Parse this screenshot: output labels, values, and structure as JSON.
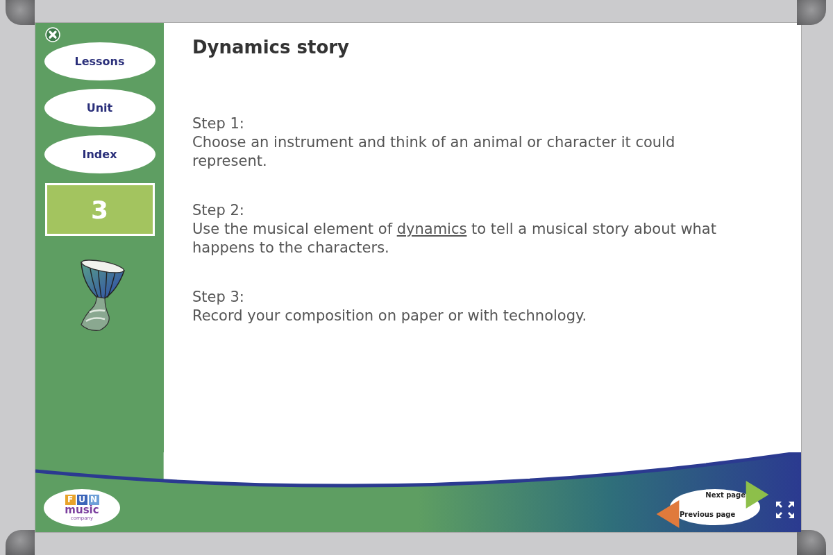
{
  "sidebar": {
    "menu": [
      {
        "label": "Lessons"
      },
      {
        "label": "Unit"
      },
      {
        "label": "Index"
      }
    ],
    "page_number": "3"
  },
  "title": "Dynamics story",
  "steps": [
    {
      "heading": "Step 1:",
      "parts": [
        {
          "text": "Choose an instrument and think of an animal or character it could represent.",
          "link": false
        }
      ]
    },
    {
      "heading": "Step 2:",
      "parts": [
        {
          "text": "Use the musical element of ",
          "link": false
        },
        {
          "text": "dynamics",
          "link": true
        },
        {
          "text": " to tell a musical story about what happens to the characters.",
          "link": false
        }
      ]
    },
    {
      "heading": "Step 3:",
      "parts": [
        {
          "text": "Record your composition on paper or with technology.",
          "link": false
        }
      ]
    }
  ],
  "logo": {
    "letters": [
      {
        "char": "F",
        "color": "#e8a32a"
      },
      {
        "char": "U",
        "color": "#3b64b8"
      },
      {
        "char": "N",
        "color": "#6fa0d8"
      }
    ],
    "word": "music",
    "tagline": "company"
  },
  "nav": {
    "next": "Next page",
    "previous": "Previous page"
  }
}
